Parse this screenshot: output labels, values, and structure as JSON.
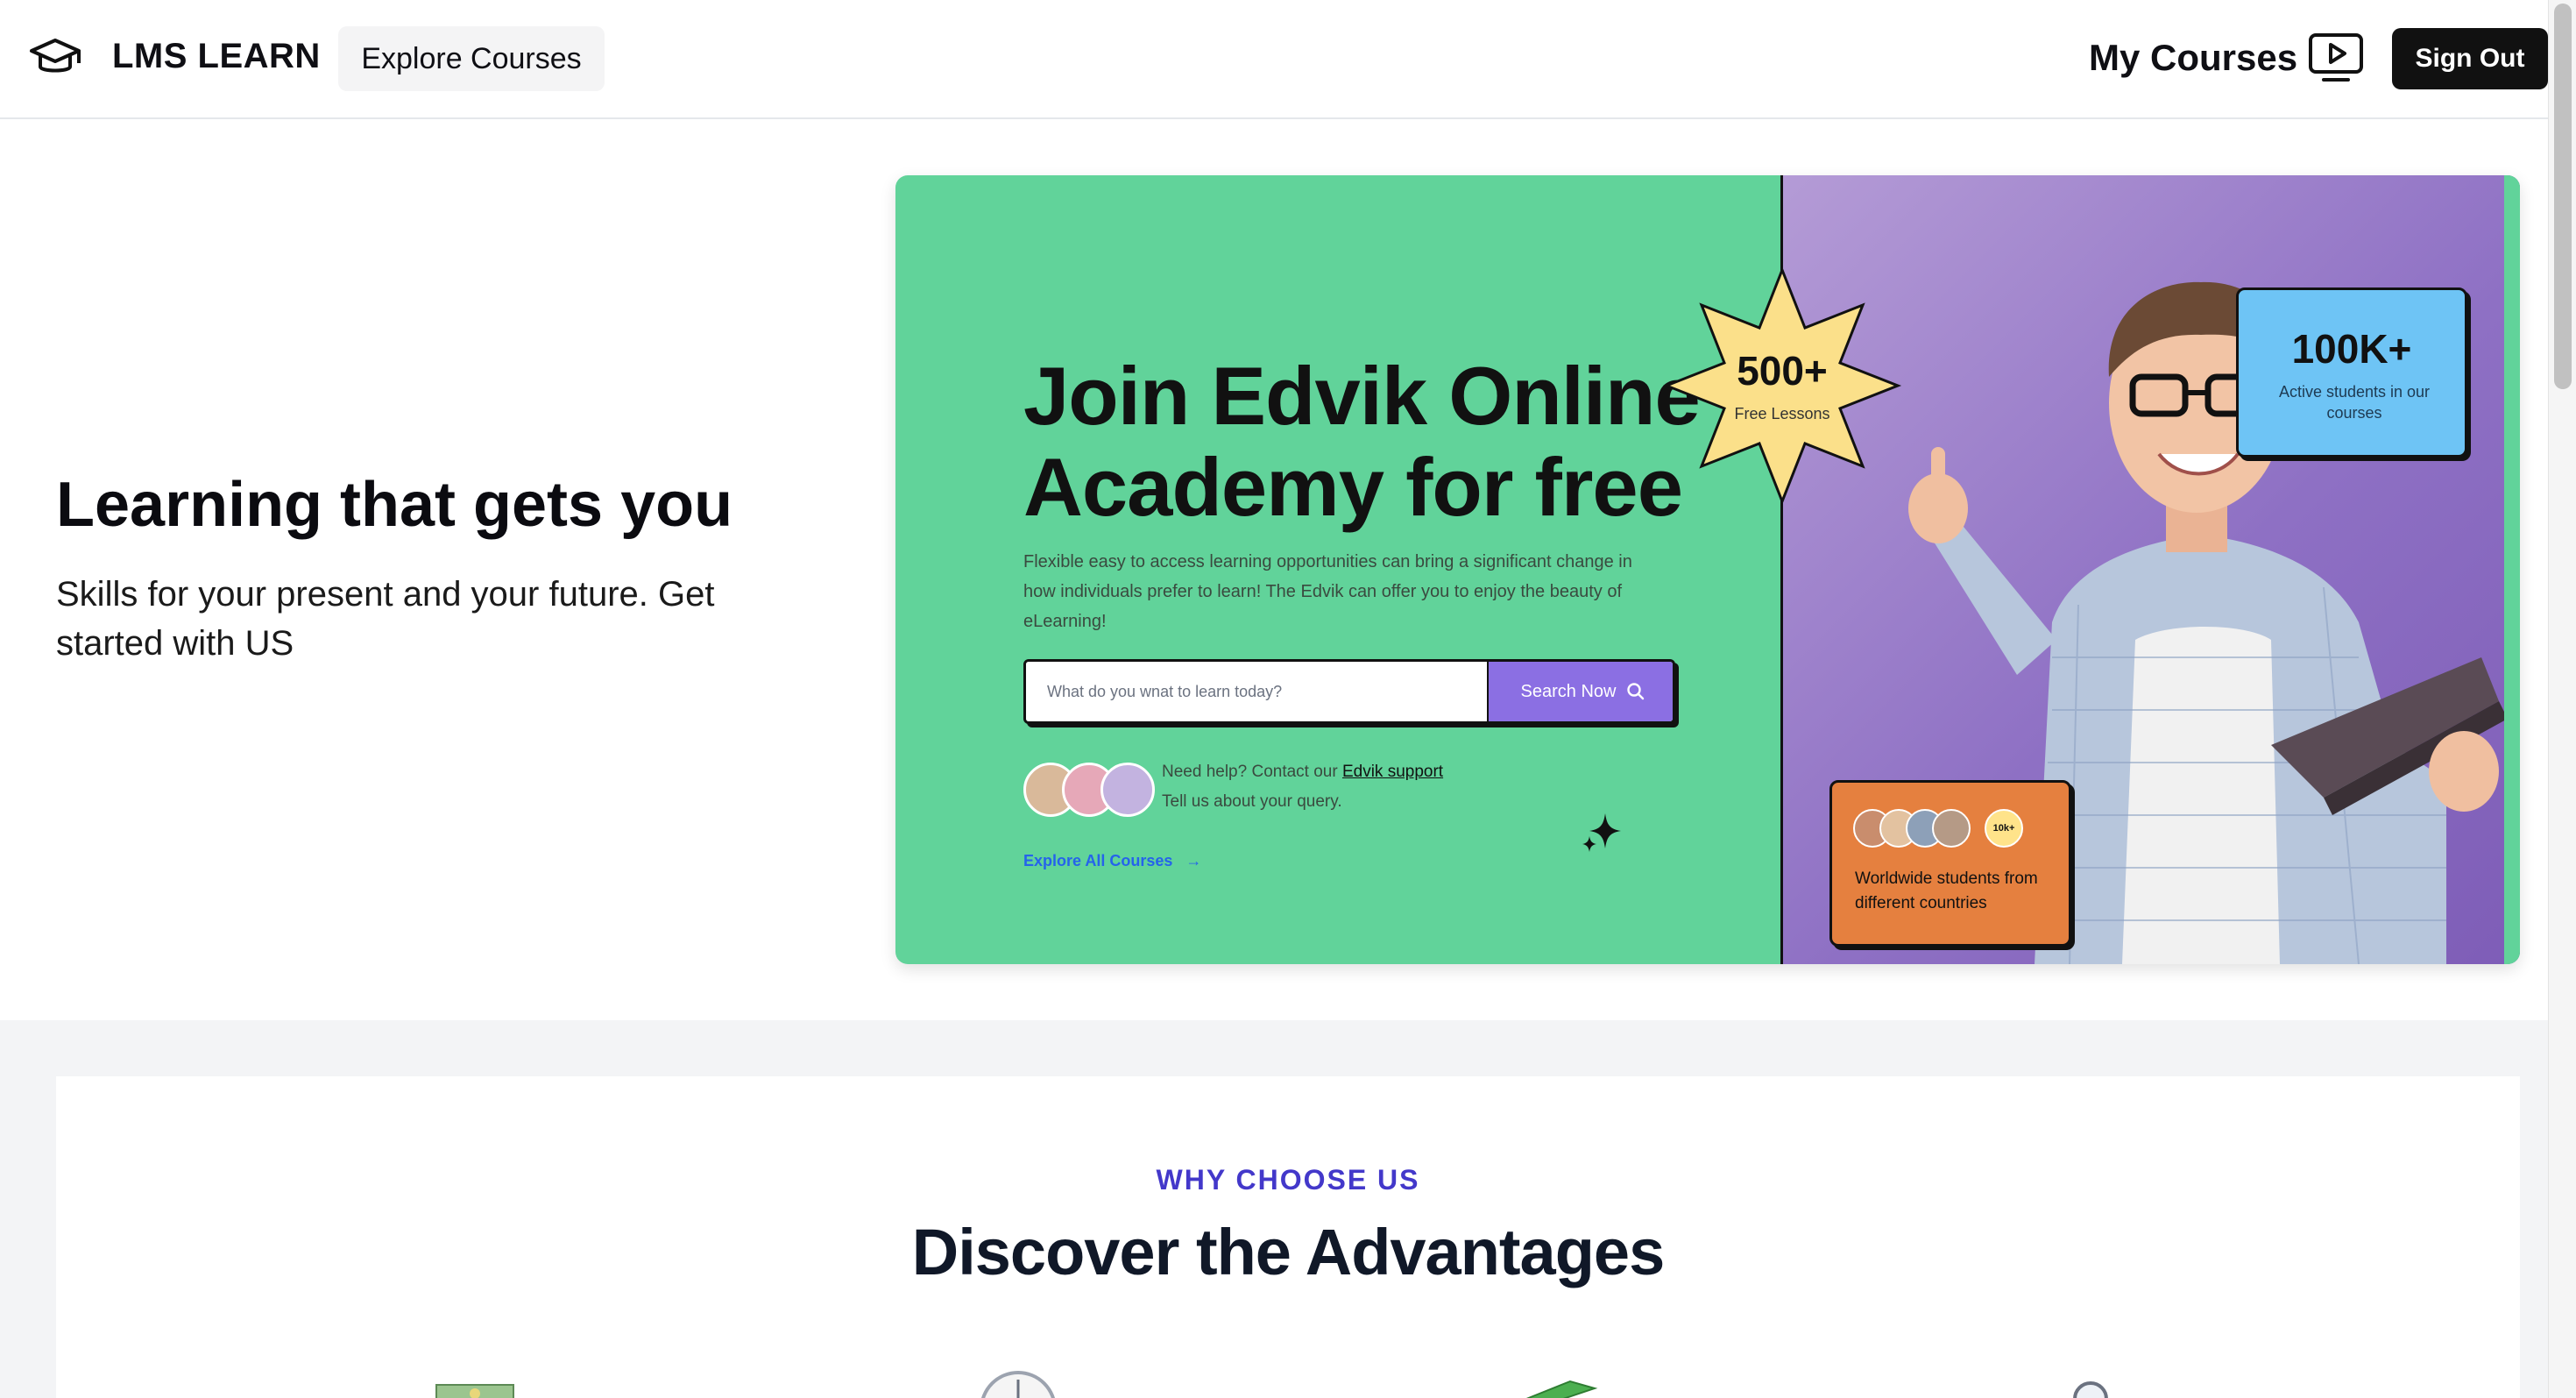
{
  "header": {
    "brand": "LMS LEARN",
    "explore_label": "Explore Courses",
    "my_courses_label": "My Courses",
    "sign_out_label": "Sign Out"
  },
  "hero": {
    "title": "Learning that gets you",
    "subtitle": "Skills for your present and your future. Get started with US"
  },
  "banner": {
    "title": "Join Edvik Online Academy for free",
    "description": "Flexible easy to access learning opportunities can bring a significant change in how individuals prefer to learn! The Edvik can offer you to enjoy the beauty of eLearning!",
    "search_placeholder": "What do you wnat to learn today?",
    "search_button": "Search Now",
    "help_prefix": "Need help? Contact our ",
    "help_link": "Edvik support",
    "help_line2": "Tell us about your query.",
    "explore_all": "Explore All Courses",
    "badge_number": "500+",
    "badge_label": "Free Lessons",
    "stat_number": "100K+",
    "stat_label": "Active students in our courses",
    "world_count": "10k+",
    "world_label": "Worldwide students from different countries"
  },
  "advantages": {
    "eyebrow": "WHY CHOOSE US",
    "title": "Discover the Advantages",
    "icons": [
      "money-icon",
      "clock-icon",
      "book-icon",
      "search-icon"
    ]
  },
  "colors": {
    "banner_green": "#61d39a",
    "banner_purple": "#8e70c4",
    "search_button": "#8b6fe3",
    "stat_card": "#6ec4f5",
    "world_card": "#e5803f",
    "eyebrow": "#4338ca"
  }
}
